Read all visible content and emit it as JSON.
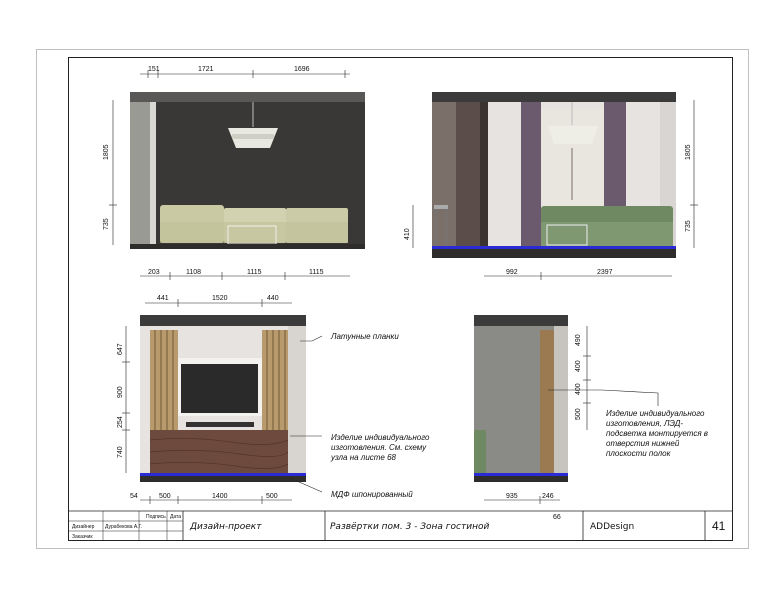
{
  "elevations": {
    "top_left": {
      "dims_top": [
        "151",
        "1721",
        "1696"
      ],
      "dims_left": [
        "1805",
        "735"
      ],
      "dims_bottom": [
        "203",
        "1108",
        "1115",
        "1115"
      ]
    },
    "top_right": {
      "dims_left": [
        "410"
      ],
      "dims_right": [
        "1805",
        "735"
      ],
      "dims_bottom": [
        "992",
        "2397"
      ]
    },
    "bottom_left": {
      "dims_top": [
        "441",
        "1520",
        "440"
      ],
      "dims_left": [
        "647",
        "900",
        "254",
        "740"
      ],
      "dims_bottom": [
        "54",
        "500",
        "1400",
        "500"
      ]
    },
    "bottom_right": {
      "dims_right": [
        "490",
        "400",
        "400",
        "500"
      ],
      "dims_bottom": [
        "935",
        "246"
      ],
      "dim_extra": "66"
    }
  },
  "notes": {
    "brass": "Латунные планки",
    "custom_1": "Изделие индивидуального",
    "custom_2": "изготовления. См. схему",
    "custom_3": "узла на листе 68",
    "mdf": "МДФ шпонированный",
    "led_1": "Изделие индивидуального",
    "led_2": "изготовления, ЛЭД-",
    "led_3": "подсветка монтируется в",
    "led_4": "отверстия нижней",
    "led_5": "плоскости полок"
  },
  "title_block": {
    "sign_label": "Подпись",
    "date_label": "Дата",
    "designer_label": "Дизайнер",
    "designer_name": "Дурабекова А.Г.",
    "client_label": "Заказчик",
    "project": "Дизайн-проект",
    "sheet_title": "Развёртки пом. 3 - Зона гостиной",
    "company": "ADDesign",
    "sheet_number": "41"
  },
  "colors": {
    "wall_dark": "#3a3836",
    "sofa_light": "#c9c9a4",
    "sofa_green": "#6f8a63",
    "curtain": "#6b5a6e",
    "wood": "#6e4a3e",
    "slat": "#b89a6c",
    "led": "#2b2bd6"
  }
}
